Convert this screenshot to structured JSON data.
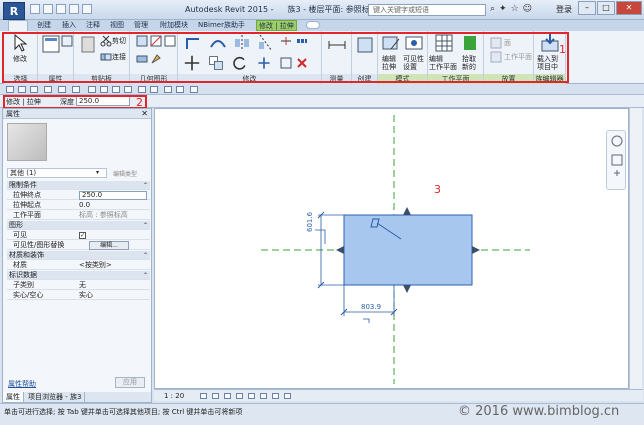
{
  "titlebar": {
    "logo": "R",
    "app_name": "Autodesk Revit 2015 -",
    "doc_title": "族3 - 楼层平面: 参照标高",
    "search_placeholder": "键入关键字或短语",
    "login": "登录"
  },
  "tabs": [
    "",
    "创建",
    "插入",
    "注释",
    "视图",
    "管理",
    "附加模块",
    "NBimer族助手",
    "修改 | 拉伸"
  ],
  "ribbon": {
    "panels": [
      {
        "label": "选择",
        "button": "修改"
      },
      {
        "label": "属性"
      },
      {
        "label": "剪贴板",
        "buttons": [
          "剪切",
          "连接"
        ]
      },
      {
        "label": "几何图形"
      },
      {
        "label": "修改"
      },
      {
        "label": "测量"
      },
      {
        "label": "创建"
      },
      {
        "label": "模式",
        "buttons": [
          "编辑\n拉伸",
          "可见性\n设置"
        ]
      },
      {
        "label": "工作平面",
        "buttons": [
          "编辑\n工作平面",
          "拾取\n新的"
        ]
      },
      {
        "label": "放置",
        "buttons": [
          "面",
          "工作平面"
        ]
      },
      {
        "label": "族编辑器",
        "buttons": [
          "载入到\n项目中"
        ]
      }
    ],
    "annotation_number": "1"
  },
  "options_bar": {
    "mode": "修改 | 拉伸",
    "depth_label": "深度",
    "depth_value": "250.0",
    "annotation_number": "2"
  },
  "properties": {
    "header": "属性",
    "family_select": "其他 (1)",
    "edit_type": "编辑类型",
    "rows": [
      {
        "type": "section",
        "label": "限制条件"
      },
      {
        "type": "field",
        "label": "拉伸终点",
        "value": "250.0",
        "style": "box"
      },
      {
        "type": "field",
        "label": "拉伸起点",
        "value": "0.0",
        "style": "plain"
      },
      {
        "type": "field",
        "label": "工作平面",
        "value": "标高 : 参照标高",
        "style": "gray"
      },
      {
        "type": "section",
        "label": "图形"
      },
      {
        "type": "check",
        "label": "可见",
        "value": "✓"
      },
      {
        "type": "button",
        "label": "可见性/图形替换",
        "value": "编辑..."
      },
      {
        "type": "section",
        "label": "材质和装饰"
      },
      {
        "type": "field",
        "label": "材质",
        "value": "<按类别>",
        "style": "plain"
      },
      {
        "type": "section",
        "label": "标识数据"
      },
      {
        "type": "field",
        "label": "子类别",
        "value": "无",
        "style": "plain"
      },
      {
        "type": "field",
        "label": "实心/空心",
        "value": "实心",
        "style": "plain"
      }
    ],
    "help": "属性帮助",
    "apply": "应用",
    "tabs": [
      "属性",
      "项目浏览器 - 族3"
    ]
  },
  "canvas": {
    "annotation_number": "3",
    "dim_vertical": "601.6",
    "dim_horizontal": "803.9"
  },
  "viewbar": {
    "scale": "1 : 20"
  },
  "status": {
    "text": "单击可进行选择; 按 Tab 键并单击可选择其他项目; 按 Ctrl 键并单击可将新项",
    "copyright": "© 2016 www.bimblog.cn"
  },
  "colors": {
    "accent_red": "#e0252b",
    "shape_fill": "#a7c7ef",
    "ref_line": "#3aa33a",
    "dim": "#2a5ca8"
  }
}
